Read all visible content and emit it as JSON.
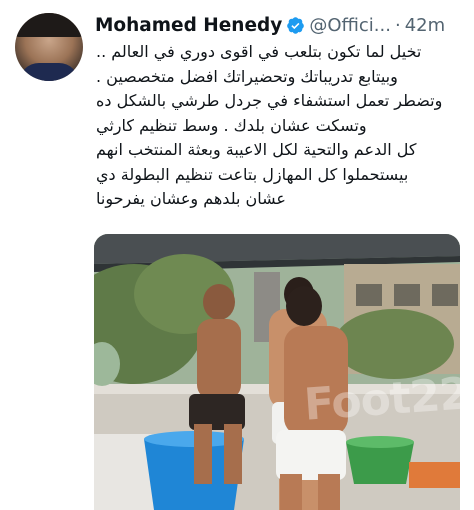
{
  "tweet": {
    "author_name": "Mohamed Henedy",
    "handle": "@Offici...",
    "separator": "·",
    "time": "42m",
    "lines": [
      "تخيل لما تكون بتلعب في اقوى دوري في العالم ..",
      "وبيتابع تدريباتك وتحضيراتك افضل متخصصين .",
      "وتضطر تعمل استشفاء في جردل طرشي بالشكل ده",
      "وتسكت عشان بلدك . وسط تنظيم كارثي",
      "كل الدعم والتحية لكل الاعيبة وبعثة المنتخب انهم",
      "بيستحملوا كل المهازل بتاعت تنظيم البطولة دي",
      "عشان بلدهم وعشان يفرحونا"
    ],
    "media_watermark": "Foot22"
  },
  "colors": {
    "text": "#0f1419",
    "secondary": "#536471",
    "verified": "#1d9bf0"
  },
  "icons": {
    "verified": "verified-badge-icon"
  }
}
